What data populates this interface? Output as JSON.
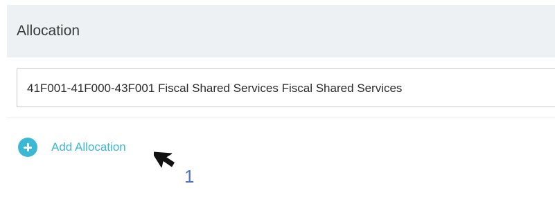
{
  "section": {
    "title": "Allocation"
  },
  "allocation": {
    "value": "41F001-41F000-43F001 Fiscal Shared Services Fiscal Shared Services"
  },
  "add_allocation": {
    "label": "Add Allocation",
    "icon": "plus-circle-icon",
    "color": "#3bb8d4"
  },
  "annotation": {
    "step": "1",
    "pointer_icon": "mouse-pointer-icon"
  }
}
